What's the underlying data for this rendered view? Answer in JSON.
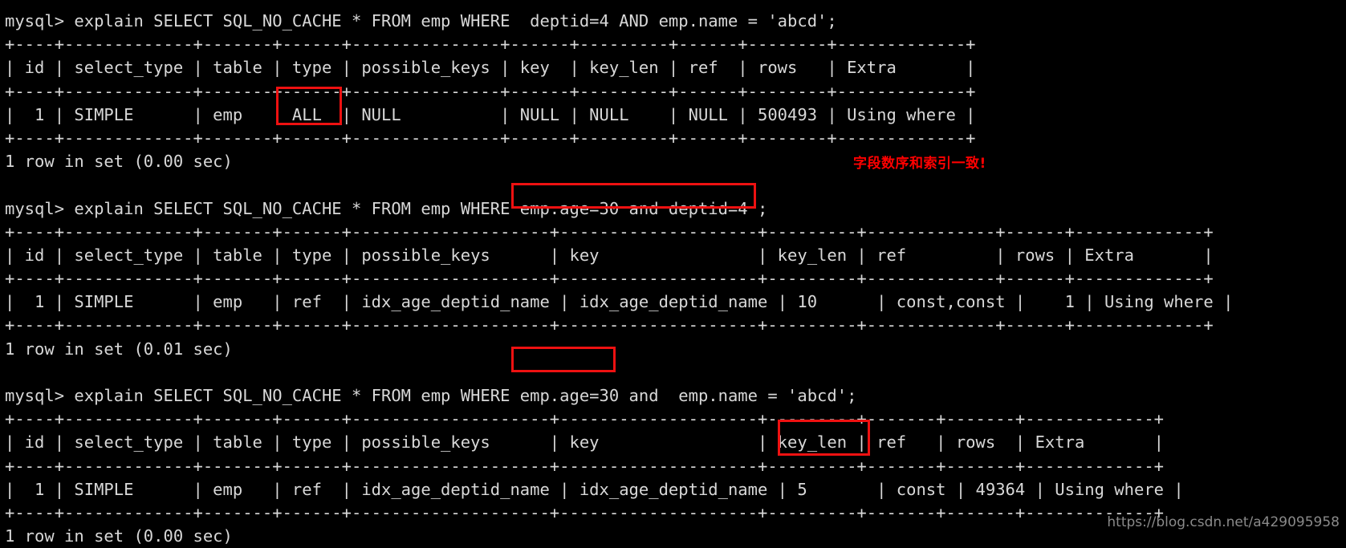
{
  "terminal": {
    "prompt": "mysql> ",
    "background_color": "#000000",
    "text_color": "#d8d8d8",
    "highlight_color": "#ee1111",
    "annotation_color": "#ff0000"
  },
  "blocks": [
    {
      "command": "mysql> explain SELECT SQL_NO_CACHE * FROM emp WHERE  deptid=4 AND emp.name = 'abcd';",
      "rule_top": "+----+-------------+-------+------+---------------+------+---------+------+--------+-------------+",
      "header": "| id | select_type | table | type | possible_keys | key  | key_len | ref  | rows   | Extra       |",
      "rule_mid": "+----+-------------+-------+------+---------------+------+---------+------+--------+-------------+",
      "row": "|  1 | SIMPLE      | emp   | ALL  | NULL          | NULL | NULL    | NULL | 500493 | Using where |",
      "rule_bottom": "+----+-------------+-------+------+---------------+------+---------+------+--------+-------------+",
      "status": "1 row in set (0.00 sec)",
      "columns": [
        "id",
        "select_type",
        "table",
        "type",
        "possible_keys",
        "key",
        "key_len",
        "ref",
        "rows",
        "Extra"
      ],
      "values": [
        "1",
        "SIMPLE",
        "emp",
        "ALL",
        "NULL",
        "NULL",
        "NULL",
        "NULL",
        "500493",
        "Using where"
      ]
    },
    {
      "command": "mysql> explain SELECT SQL_NO_CACHE * FROM emp WHERE emp.age=30 and deptid=4 ;",
      "rule_top": "+----+-------------+-------+------+--------------------+--------------------+---------+-------------+------+-------------+",
      "header": "| id | select_type | table | type | possible_keys      | key                | key_len | ref         | rows | Extra       |",
      "rule_mid": "+----+-------------+-------+------+--------------------+--------------------+---------+-------------+------+-------------+",
      "row": "|  1 | SIMPLE      | emp   | ref  | idx_age_deptid_name | idx_age_deptid_name | 10      | const,const |    1 | Using where |",
      "rule_bottom": "+----+-------------+-------+------+--------------------+--------------------+---------+-------------+------+-------------+",
      "status": "1 row in set (0.01 sec)",
      "columns": [
        "id",
        "select_type",
        "table",
        "type",
        "possible_keys",
        "key",
        "key_len",
        "ref",
        "rows",
        "Extra"
      ],
      "values": [
        "1",
        "SIMPLE",
        "emp",
        "ref",
        "idx_age_deptid_name",
        "idx_age_deptid_name",
        "10",
        "const,const",
        "1",
        "Using where"
      ]
    },
    {
      "command": "mysql> explain SELECT SQL_NO_CACHE * FROM emp WHERE emp.age=30 and  emp.name = 'abcd';",
      "rule_top": "+----+-------------+-------+------+--------------------+--------------------+---------+-------+-------+-------------+",
      "header": "| id | select_type | table | type | possible_keys      | key                | key_len | ref   | rows  | Extra       |",
      "rule_mid": "+----+-------------+-------+------+--------------------+--------------------+---------+-------+-------+-------------+",
      "row": "|  1 | SIMPLE      | emp   | ref  | idx_age_deptid_name | idx_age_deptid_name | 5       | const | 49364 | Using where |",
      "rule_bottom": "+----+-------------+-------+------+--------------------+--------------------+---------+-------+-------+-------------+",
      "status": "1 row in set (0.00 sec)",
      "columns": [
        "id",
        "select_type",
        "table",
        "type",
        "possible_keys",
        "key",
        "key_len",
        "ref",
        "rows",
        "Extra"
      ],
      "values": [
        "1",
        "SIMPLE",
        "emp",
        "ref",
        "idx_age_deptid_name",
        "idx_age_deptid_name",
        "5",
        "const",
        "49364",
        "Using where"
      ]
    }
  ],
  "annotations": {
    "chinese_note": "字段数序和索引一致!"
  },
  "watermark": {
    "text": "https://blog.csdn.net/a429095958"
  }
}
